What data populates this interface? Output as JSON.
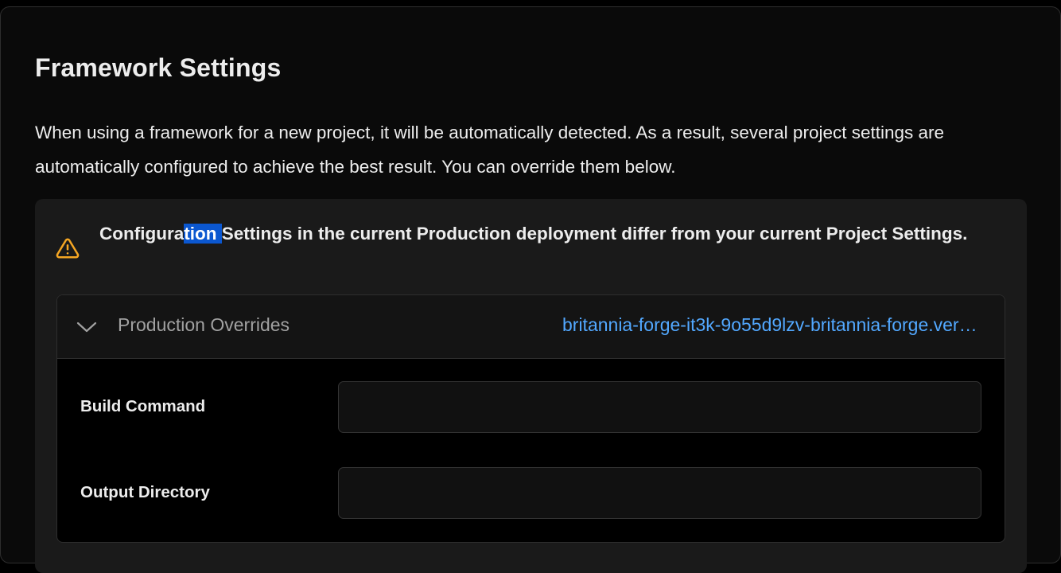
{
  "section": {
    "title": "Framework Settings",
    "description": "When using a framework for a new project, it will be automatically detected. As a result, several project settings are automatically configured to achieve the best result. You can override them below."
  },
  "warning": {
    "icon": "warning-triangle-icon",
    "text_before": "Configura",
    "text_selected": "tion ",
    "text_after": "Settings in the current Production deployment differ from your current Project Settings.",
    "color": "#f5a623"
  },
  "overrides": {
    "label": "Production Overrides",
    "deployment_link": "britannia-forge-it3k-9o55d9lzv-britannia-forge.vercel.app",
    "fields": [
      {
        "label": "Build Command",
        "value": "",
        "placeholder": ""
      },
      {
        "label": "Output Directory",
        "value": "",
        "placeholder": ""
      }
    ]
  },
  "colors": {
    "accent_link": "#52a8ff",
    "selection": "#0b57d0"
  }
}
